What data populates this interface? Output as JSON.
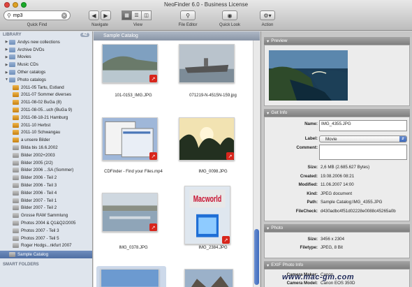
{
  "window": {
    "title": "NeoFinder 6.0 - Business License"
  },
  "toolbar": {
    "search_value": "mp3",
    "quick_find": "Quick Find",
    "navigate": "Navigate",
    "view": "View",
    "file_editor": "File Editor",
    "quick_look": "Quick Look",
    "action": "Action"
  },
  "sidebar": {
    "library_label": "LIBRARY",
    "library_count": "42",
    "items": [
      {
        "label": "Andys new collections",
        "type": "folder",
        "indent": 0,
        "disclosure": "closed"
      },
      {
        "label": "Archive DVDs",
        "type": "folder",
        "indent": 0,
        "disclosure": "closed"
      },
      {
        "label": "Movies",
        "type": "folder",
        "indent": 0,
        "disclosure": "closed"
      },
      {
        "label": "Music CDs",
        "type": "folder",
        "indent": 0,
        "disclosure": "closed"
      },
      {
        "label": "Other catalogs",
        "type": "folder",
        "indent": 0,
        "disclosure": "closed"
      },
      {
        "label": "Photo catalogs",
        "type": "folder",
        "indent": 0,
        "disclosure": "open"
      },
      {
        "label": "2011-05 Tartu, Estland",
        "type": "book",
        "indent": 1,
        "disclosure": ""
      },
      {
        "label": "2011-07 Sommer diverses",
        "type": "book",
        "indent": 1,
        "disclosure": ""
      },
      {
        "label": "2011-08-02 BuGa (8)",
        "type": "book",
        "indent": 1,
        "disclosure": ""
      },
      {
        "label": "2011-08-05...uch (BuGa 9)",
        "type": "book",
        "indent": 1,
        "disclosure": ""
      },
      {
        "label": "2011-08-18-21 Hamburg",
        "type": "book",
        "indent": 1,
        "disclosure": ""
      },
      {
        "label": "2011-10 Herbst",
        "type": "book",
        "indent": 1,
        "disclosure": ""
      },
      {
        "label": "2011-10 Schwangau",
        "type": "book",
        "indent": 1,
        "disclosure": ""
      },
      {
        "label": "a unsere Bilder",
        "type": "book",
        "indent": 1,
        "disclosure": ""
      },
      {
        "label": "Bilda bis 16.6.2002",
        "type": "cat",
        "indent": 1,
        "disclosure": ""
      },
      {
        "label": "Bilder 2002+2003",
        "type": "cat",
        "indent": 1,
        "disclosure": ""
      },
      {
        "label": "Bilder 2005 (2/2)",
        "type": "cat",
        "indent": 1,
        "disclosure": ""
      },
      {
        "label": "Bilder 2006 ...SA (Sommer)",
        "type": "cat",
        "indent": 1,
        "disclosure": ""
      },
      {
        "label": "Bilder 2006 - Teil 2",
        "type": "cat",
        "indent": 1,
        "disclosure": ""
      },
      {
        "label": "Bilder 2006 - Teil 3",
        "type": "cat",
        "indent": 1,
        "disclosure": ""
      },
      {
        "label": "Bilder 2006 - Teil 4",
        "type": "cat",
        "indent": 1,
        "disclosure": ""
      },
      {
        "label": "Bilder 2007 - Teil 1",
        "type": "cat",
        "indent": 1,
        "disclosure": ""
      },
      {
        "label": "Bilder 2007 - Teil 2",
        "type": "cat",
        "indent": 1,
        "disclosure": ""
      },
      {
        "label": "Grosse RAW Sammlung",
        "type": "cat",
        "indent": 1,
        "disclosure": ""
      },
      {
        "label": "Photos 2004 & Q1&Q2/2005",
        "type": "cat",
        "indent": 1,
        "disclosure": ""
      },
      {
        "label": "Photos 2007 - Teil 3",
        "type": "cat",
        "indent": 1,
        "disclosure": ""
      },
      {
        "label": "Photos 2007 - Teil 5",
        "type": "cat",
        "indent": 1,
        "disclosure": ""
      },
      {
        "label": "Roger Hodgs...nkfurt 2007",
        "type": "cat",
        "indent": 1,
        "disclosure": ""
      },
      {
        "label": "Sample Catalog",
        "type": "cat",
        "indent": 0,
        "disclosure": "",
        "selected": true
      }
    ],
    "smart_folders_label": "SMART FOLDERS"
  },
  "main": {
    "catalog_name": "Sample Catalog",
    "items": [
      {
        "name": "101-0153_IMG.JPG",
        "kind": "coast",
        "badge": true
      },
      {
        "name": "071219-N-4515N-159.jpg",
        "kind": "carrier",
        "badge": false
      },
      {
        "name": "CDFinder - Find your Files.mp4",
        "kind": "screen",
        "badge": true
      },
      {
        "name": "IMG_0098.JPG",
        "kind": "sunset",
        "badge": true
      },
      {
        "name": "IMG_0378.JPG",
        "kind": "lake",
        "badge": true
      },
      {
        "name": "IMG_2384.JPG",
        "kind": "macworld",
        "badge": true
      },
      {
        "name": "",
        "kind": "sky",
        "badge": false
      },
      {
        "name": "",
        "kind": "mountain",
        "badge": false
      }
    ],
    "macworld_text": "Macworld"
  },
  "inspector": {
    "preview_title": "Preview",
    "getinfo_title": "Get Info",
    "name_label": "Name:",
    "name_value": "IMG_4355.JPG",
    "label_label": "Label:",
    "label_value": "Movie",
    "comment_label": "Comment:",
    "rows": [
      {
        "k": "Size:",
        "v": "2,6 MB (2.685.627 Bytes)"
      },
      {
        "k": "Created:",
        "v": "19.08.2006 08:21"
      },
      {
        "k": "Modified:",
        "v": "11.06.2007 14:00"
      },
      {
        "k": "Kind:",
        "v": "JPEG document"
      },
      {
        "k": "Path:",
        "v": "Sample Catalog:IMG_4355.JPG"
      },
      {
        "k": "FileCheck:",
        "v": "d430adbc4f51d02228e0088c45265a0b"
      }
    ],
    "photo_title": "Photo",
    "photo_rows": [
      {
        "k": "Size:",
        "v": "3456 x 2304"
      },
      {
        "k": "Filetype:",
        "v": "JPEG, 8 Bit"
      }
    ],
    "exif_title": "EXIF Photo Info",
    "exif_rows": [
      {
        "k": "Camera Maker:",
        "v": "Canon"
      },
      {
        "k": "Camera Model:",
        "v": "Canon EOS 350D"
      }
    ]
  },
  "watermark": "www.mac-gm.com"
}
